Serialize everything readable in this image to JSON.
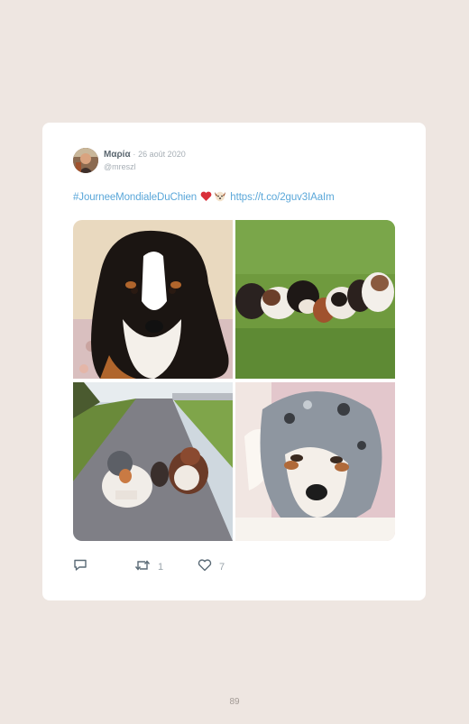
{
  "tweet": {
    "author_name": "Μαρία",
    "date_separator": "·",
    "date": "26 août 2020",
    "handle": "@mreszl",
    "hashtag": "#JourneeMondialeDuChien",
    "link": "https://t.co/2guv3IAaIm",
    "emojis": [
      "red-heart",
      "dog-face"
    ],
    "photos": [
      {
        "description_icon": "bernese-puppy-photo"
      },
      {
        "description_icon": "puppies-on-grass-photo"
      },
      {
        "description_icon": "two-dogs-on-path-photo"
      },
      {
        "description_icon": "merle-puppy-photo"
      }
    ],
    "actions": {
      "reply_count": "",
      "retweet_count": "1",
      "like_count": "7"
    }
  },
  "colors": {
    "page_background": "#eee6e1",
    "card": "#ffffff",
    "link": "#5aa7d9",
    "muted": "#a6aeb5",
    "icon": "#5a6a76"
  },
  "page": {
    "number": "89"
  }
}
